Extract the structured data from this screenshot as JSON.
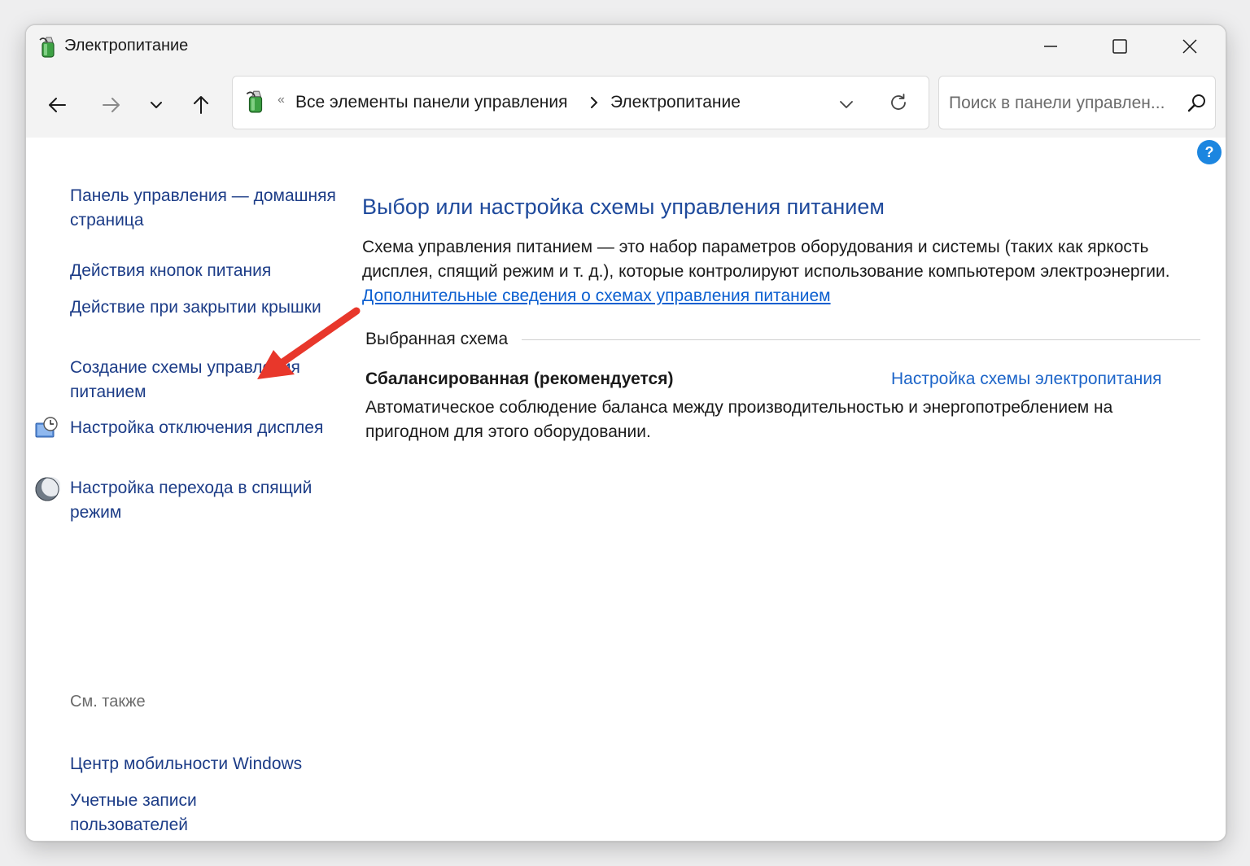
{
  "window": {
    "title": "Электропитание",
    "controls": {
      "minimize": "minimize",
      "maximize": "maximize",
      "close": "close"
    }
  },
  "toolbar": {
    "address": {
      "overflow": "«",
      "crumbs": [
        "Все элементы панели управления",
        "Электропитание"
      ]
    },
    "search": {
      "placeholder": "Поиск в панели управлен..."
    }
  },
  "help": {
    "label": "?"
  },
  "sidebar": {
    "links": [
      {
        "label": "Панель управления — домашняя страница"
      },
      {
        "label": "Действия кнопок питания"
      },
      {
        "label": "Действие при закрытии крышки"
      },
      {
        "label": "Создание схемы управления питанием"
      },
      {
        "label": "Настройка отключения дисплея",
        "icon": "monitor-clock-icon"
      },
      {
        "label": "Настройка перехода в спящий режим",
        "icon": "moon-icon"
      }
    ],
    "see_also": {
      "heading": "См. также",
      "links": [
        {
          "label": "Центр мобильности Windows"
        },
        {
          "label": "Учетные записи пользователей"
        }
      ]
    }
  },
  "main": {
    "title": "Выбор или настройка схемы управления питанием",
    "description": "Схема управления питанием — это набор параметров оборудования и системы (таких как яркость дисплея, спящий режим и т. д.), которые контролируют использование компьютером электроэнергии.",
    "more_info_link": "Дополнительные сведения о схемах управления питанием",
    "group_label": "Выбранная схема",
    "plan": {
      "name": "Сбалансированная (рекомендуется)",
      "settings_link": "Настройка схемы электропитания",
      "description": "Автоматическое соблюдение баланса между производительностью и энергопотреблением на пригодном для этого оборудовании."
    }
  },
  "colors": {
    "link_dark": "#1c3c87",
    "link_blue": "#1c64c8",
    "title_blue": "#1f4a9c",
    "annotation_arrow": "#e8372b",
    "help_badge": "#1c86e0"
  }
}
